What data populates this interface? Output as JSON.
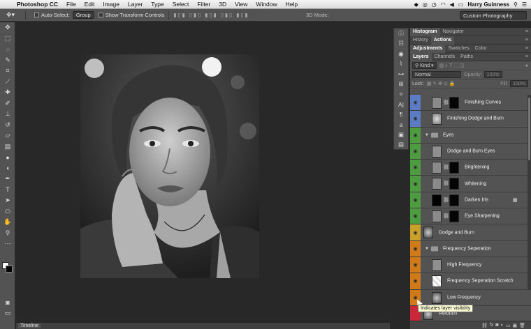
{
  "menubar": {
    "app_name": "Photoshop CC",
    "items": [
      "File",
      "Edit",
      "Image",
      "Layer",
      "Type",
      "Select",
      "Filter",
      "3D",
      "View",
      "Window",
      "Help"
    ],
    "user": "Harry Guinness"
  },
  "options_bar": {
    "auto_select_label": "Auto-Select:",
    "auto_select_value": "Group",
    "show_transform_label": "Show Transform Controls",
    "mode_3d_label": "3D Mode:",
    "workspace": "Custom Photography"
  },
  "panels": {
    "row1_tabs": [
      "Histogram",
      "Navigator"
    ],
    "row2_tabs": [
      "History",
      "Actions"
    ],
    "row3_tabs": [
      "Adjustments",
      "Swatches",
      "Color"
    ],
    "layers_tabs": [
      "Layers",
      "Channels",
      "Paths"
    ],
    "filter_kind": "Kind",
    "blend_mode": "Normal",
    "opacity_label": "Opacity:",
    "opacity_value": "100%",
    "lock_label": "Lock:",
    "fill_label": "Fill:",
    "fill_value": "100%"
  },
  "layers": [
    {
      "name": "Finishing Curves",
      "color": "#5b7cc4",
      "type": "adjust"
    },
    {
      "name": "Finishing Dodge and Burn",
      "color": "#5b7cc4",
      "type": "pixel"
    },
    {
      "name": "Eyes",
      "color": "#4d9c3f",
      "type": "group"
    },
    {
      "name": "Dodge and Burn Eyes",
      "color": "#4d9c3f",
      "type": "pixel"
    },
    {
      "name": "Brightening",
      "color": "#4d9c3f",
      "type": "adjust"
    },
    {
      "name": "Whitening",
      "color": "#4d9c3f",
      "type": "adjust"
    },
    {
      "name": "Darken Iris",
      "color": "#4d9c3f",
      "type": "adjust"
    },
    {
      "name": "Eye Sharpening",
      "color": "#4d9c3f",
      "type": "adjust"
    },
    {
      "name": "Dodge and Burn",
      "color": "#c9a12a",
      "type": "pixel"
    },
    {
      "name": "Frequency Seperation",
      "color": "#d07a1a",
      "type": "group"
    },
    {
      "name": "High Frequency",
      "color": "#d07a1a",
      "type": "pixel"
    },
    {
      "name": "Frequency Seperation Scratch",
      "color": "#d07a1a",
      "type": "pixel"
    },
    {
      "name": "Low Frequency",
      "color": "#d07a1a",
      "type": "pixel"
    },
    {
      "name": "Retouch",
      "color": "#c8283a",
      "type": "pixel"
    }
  ],
  "tooltip": "Indicates layer visibility",
  "timeline_label": "Timeline",
  "colors": {
    "ui_dark": "#282828",
    "panel": "#535353",
    "tooltip_bg": "#ffffd8"
  }
}
